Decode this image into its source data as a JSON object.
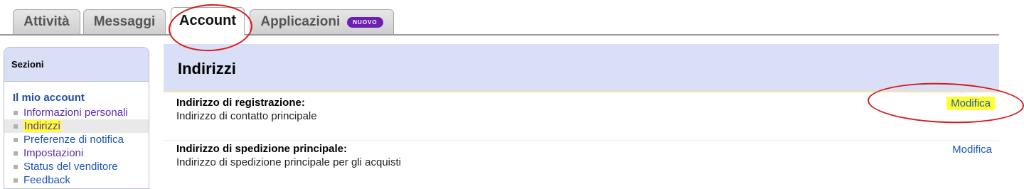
{
  "tabs": {
    "activity": "Attività",
    "messages": "Messaggi",
    "account": "Account",
    "applications": "Applicazioni",
    "new_badge": "NUOVO"
  },
  "sidebar": {
    "title": "Sezioni",
    "group_label": "Il mio account",
    "items": [
      {
        "label": "Informazioni personali"
      },
      {
        "label": "Indirizzi"
      },
      {
        "label": "Preferenze di notifica"
      },
      {
        "label": "Impostazioni"
      },
      {
        "label": "Status del venditore"
      },
      {
        "label": "Feedback"
      }
    ]
  },
  "main": {
    "title": "Indirizzi",
    "rows": [
      {
        "title": "Indirizzo di registrazione:",
        "subtitle": "Indirizzo di contatto principale",
        "action": "Modifica"
      },
      {
        "title": "Indirizzo di spedizione principale:",
        "subtitle": "Indirizzo di spedizione principale per gli acquisti",
        "action": "Modifica"
      }
    ]
  },
  "colors": {
    "header_bg": "#d9dff7",
    "link": "#1f55b5",
    "visited_link": "#5a2db0",
    "highlight": "#ffff33",
    "annotation": "#d61b1b",
    "badge": "#6b1fb3"
  }
}
